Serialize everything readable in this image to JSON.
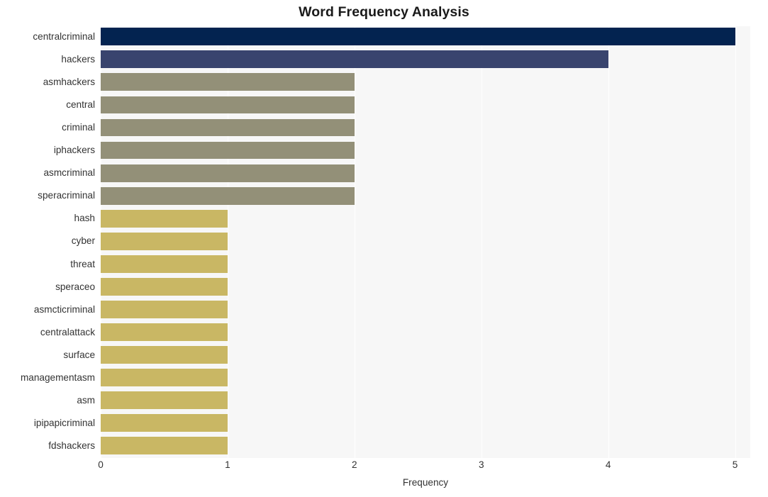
{
  "chart_data": {
    "type": "bar",
    "orientation": "horizontal",
    "title": "Word Frequency Analysis",
    "xlabel": "Frequency",
    "ylabel": "",
    "categories": [
      "centralcriminal",
      "hackers",
      "asmhackers",
      "central",
      "criminal",
      "iphackers",
      "asmcriminal",
      "speracriminal",
      "hash",
      "cyber",
      "threat",
      "speraceo",
      "asmcticriminal",
      "centralattack",
      "surface",
      "managementasm",
      "asm",
      "ipipapicriminal",
      "fdshackers"
    ],
    "values": [
      5,
      4,
      2,
      2,
      2,
      2,
      2,
      2,
      1,
      1,
      1,
      1,
      1,
      1,
      1,
      1,
      1,
      1,
      1
    ],
    "bar_colors": [
      "#032350",
      "#39446e",
      "#939078",
      "#939078",
      "#939078",
      "#939078",
      "#939078",
      "#939078",
      "#c9b764",
      "#c9b764",
      "#c9b764",
      "#c9b764",
      "#c9b764",
      "#c9b764",
      "#c9b764",
      "#c9b764",
      "#c9b764",
      "#c9b764",
      "#c9b764"
    ],
    "xticks": [
      "0",
      "1",
      "2",
      "3",
      "4",
      "5"
    ],
    "xtick_values": [
      0,
      1,
      2,
      3,
      4,
      5
    ],
    "xlim": [
      0,
      5.12
    ],
    "grid": true,
    "grid_color": "#ffffff",
    "plot_background": "#f7f7f7",
    "figure_background": "#ffffff",
    "legend": null
  }
}
